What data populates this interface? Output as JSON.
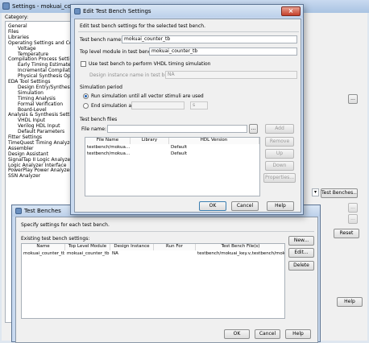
{
  "settings": {
    "title": "Settings - mokuai_counter",
    "category_label": "Category:",
    "tree": [
      {
        "label": "General",
        "indent": 0
      },
      {
        "label": "Files",
        "indent": 0
      },
      {
        "label": "Libraries",
        "indent": 0
      },
      {
        "label": "Operating Settings and Cor",
        "indent": 0
      },
      {
        "label": "Voltage",
        "indent": 2
      },
      {
        "label": "Temperature",
        "indent": 2
      },
      {
        "label": "Compilation Process Setting",
        "indent": 0
      },
      {
        "label": "Early Timing Estimate",
        "indent": 2
      },
      {
        "label": "Incremental Compilation",
        "indent": 2
      },
      {
        "label": "Physical Synthesis Optim",
        "indent": 2
      },
      {
        "label": "EDA Tool Settings",
        "indent": 0
      },
      {
        "label": "Design Entry/Synthesis",
        "indent": 2
      },
      {
        "label": "Simulation",
        "indent": 2
      },
      {
        "label": "Timing Analysis",
        "indent": 2
      },
      {
        "label": "Formal Verification",
        "indent": 2
      },
      {
        "label": "Board-Level",
        "indent": 2
      },
      {
        "label": "Analysis & Synthesis Setting",
        "indent": 0
      },
      {
        "label": "VHDL Input",
        "indent": 2
      },
      {
        "label": "Verilog HDL Input",
        "indent": 2
      },
      {
        "label": "Default Parameters",
        "indent": 2
      },
      {
        "label": "Fitter Settings",
        "indent": 0
      },
      {
        "label": "TimeQuest Timing Analyzer",
        "indent": 0
      },
      {
        "label": "Assembler",
        "indent": 0
      },
      {
        "label": "Design Assistant",
        "indent": 0
      },
      {
        "label": "SignalTap II Logic Analyzer",
        "indent": 0
      },
      {
        "label": "Logic Analyzer Interface",
        "indent": 0
      },
      {
        "label": "PowerPlay Power Analyzer",
        "indent": 0
      },
      {
        "label": "SSN Analyzer",
        "indent": 0
      }
    ],
    "test_benches_button": "Test Benches...",
    "browse_button": "...",
    "reset_button": "Reset",
    "help_button": "Help"
  },
  "edit_dialog": {
    "title": "Edit Test Bench Settings",
    "description": "Edit test bench settings for the selected test bench.",
    "test_bench_name_label": "Test bench name:",
    "test_bench_name_value": "mokuai_counter_tb",
    "top_level_label": "Top level module in test bench:",
    "top_level_value": "mokuai_counter_tb",
    "use_vhdl_label": "Use test bench to perform VHDL timing simulation",
    "use_vhdl_checked": false,
    "design_instance_label": "Design instance name in test bench:",
    "design_instance_value": "NA",
    "simulation_period_label": "Simulation period",
    "run_until_label": "Run simulation until all vector stimuli are used",
    "end_sim_label": "End simulation at:",
    "end_sim_unit": "s",
    "files_group_label": "Test bench files",
    "file_name_label": "File name:",
    "add_button": "Add",
    "remove_button": "Remove",
    "up_button": "Up",
    "down_button": "Down",
    "properties_button": "Properties...",
    "columns": [
      "File Name",
      "Library",
      "HDL Version"
    ],
    "rows": [
      [
        "testbench/mokua...",
        "",
        "Default"
      ],
      [
        "testbench/mokua...",
        "",
        "Default"
      ]
    ],
    "ok_button": "OK",
    "cancel_button": "Cancel",
    "help_button": "Help"
  },
  "testbenches_dialog": {
    "title": "Test Benches",
    "description": "Specify settings for each test bench.",
    "existing_label": "Existing test bench settings:",
    "columns": [
      "Name",
      "Top Level Module",
      "Design Instance",
      "Run For",
      "Test Bench File(s)"
    ],
    "rows": [
      [
        "mokuai_counter_tb",
        "mokuai_counter_tb",
        "NA",
        "",
        "testbench/mokuai_key.v,testbench/moku..."
      ]
    ],
    "new_button": "New...",
    "edit_button": "Edit...",
    "delete_button": "Delete",
    "ok_button": "OK",
    "cancel_button": "Cancel",
    "help_button": "Help"
  },
  "icons": {
    "close": "×",
    "app": "gear-icon",
    "dropdown": "chevron-down-icon"
  }
}
